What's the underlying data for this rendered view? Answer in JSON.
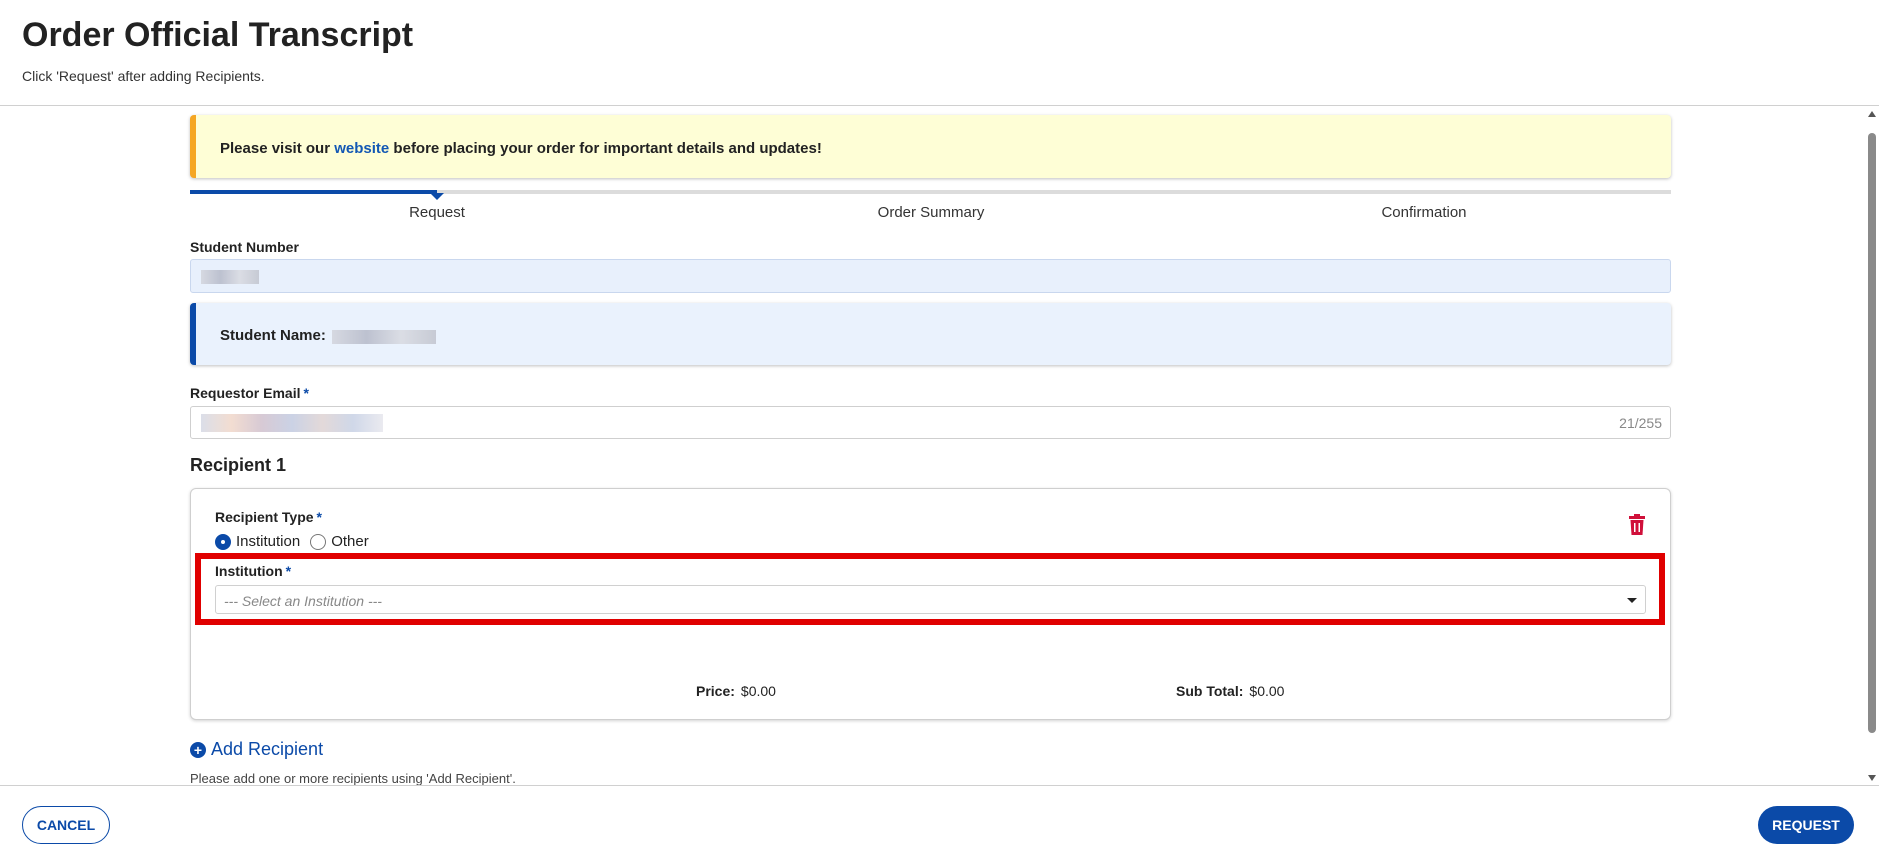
{
  "header": {
    "title": "Order Official Transcript",
    "subtitle": "Click 'Request' after adding Recipients."
  },
  "notice": {
    "before": "Please visit our ",
    "link": "website",
    "after": " before placing your order for important details and updates!",
    "accent_color": "#f5a623"
  },
  "stepper": {
    "steps": [
      "Request",
      "Order Summary",
      "Confirmation"
    ],
    "active_step": "Request"
  },
  "student_number": {
    "label": "Student Number"
  },
  "student_name": {
    "label": "Student Name:"
  },
  "requestor_email": {
    "label": "Requestor Email",
    "required_mark": "*",
    "char_count": "21/255"
  },
  "recipient": {
    "title": "Recipient 1",
    "type_label": "Recipient Type",
    "required_mark": "*",
    "options": [
      "Institution",
      "Other"
    ],
    "selected_option": "Institution",
    "institution_label": "Institution",
    "institution_placeholder": "--- Select an Institution ---",
    "price_label": "Price:",
    "price_value": "$0.00",
    "subtotal_label": "Sub Total:",
    "subtotal_value": "$0.00",
    "delete_icon": "trash-icon",
    "highlight_color": "#e00000"
  },
  "add_recipient": {
    "label": "Add Recipient",
    "help": "Please add one or more recipients using 'Add Recipient'."
  },
  "footer": {
    "cancel_label": "CANCEL",
    "request_label": "REQUEST"
  },
  "colors": {
    "primary": "#0b4aa8",
    "danger": "#d0103a"
  }
}
